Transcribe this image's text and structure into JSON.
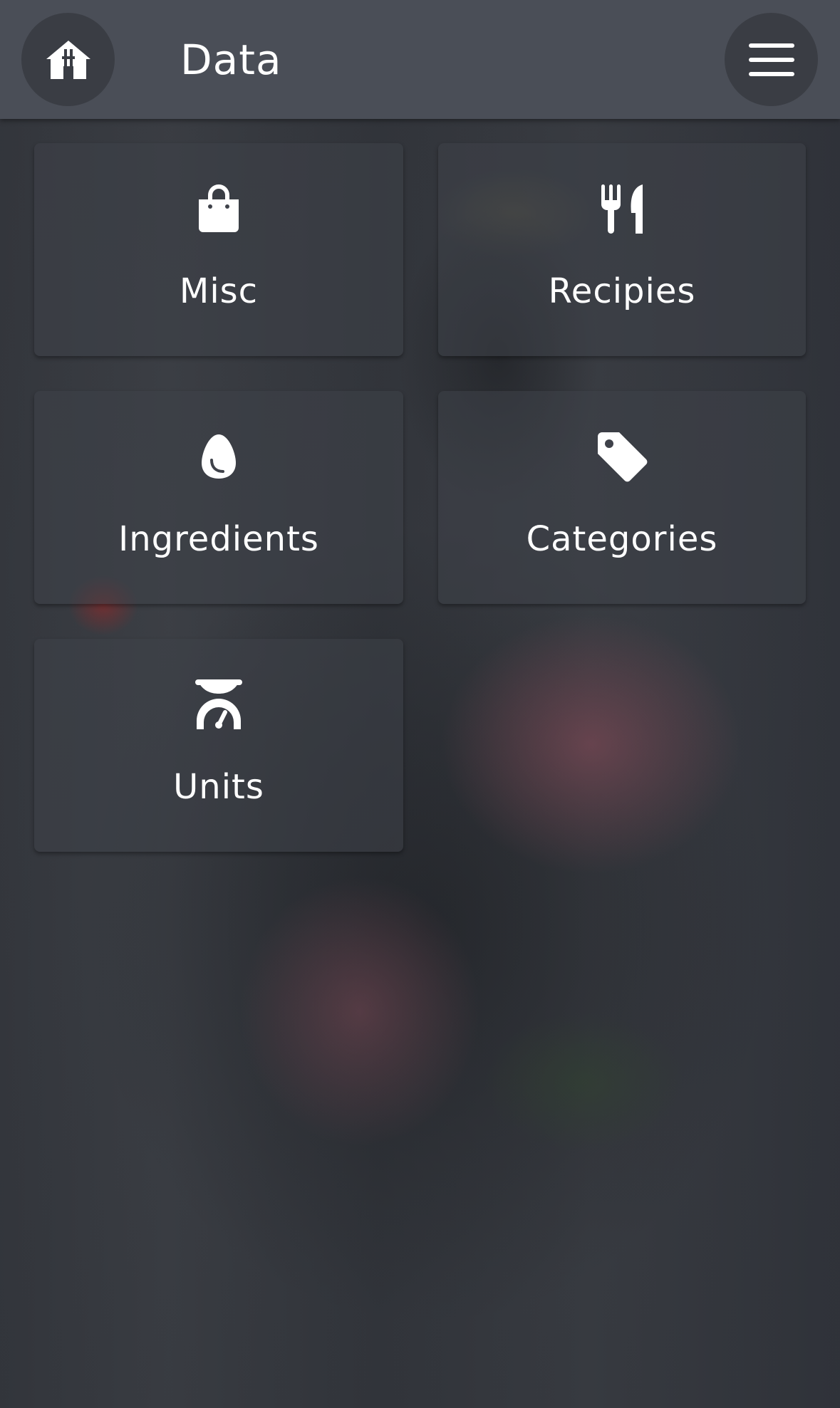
{
  "header": {
    "title": "Data",
    "home_icon": "home-icon",
    "menu_icon": "hamburger-menu-icon",
    "background_color": "#4a4e57",
    "button_color": "#3a3d44"
  },
  "cards": [
    {
      "label": "Misc",
      "icon": "shopping-bag-icon"
    },
    {
      "label": "Recipies",
      "icon": "utensils-icon"
    },
    {
      "label": "Ingredients",
      "icon": "egg-icon"
    },
    {
      "label": "Categories",
      "icon": "tag-icon"
    },
    {
      "label": "Units",
      "icon": "scale-icon"
    }
  ],
  "colors": {
    "text": "#ffffff",
    "card_background": "rgba(62,65,72,0.55)"
  }
}
